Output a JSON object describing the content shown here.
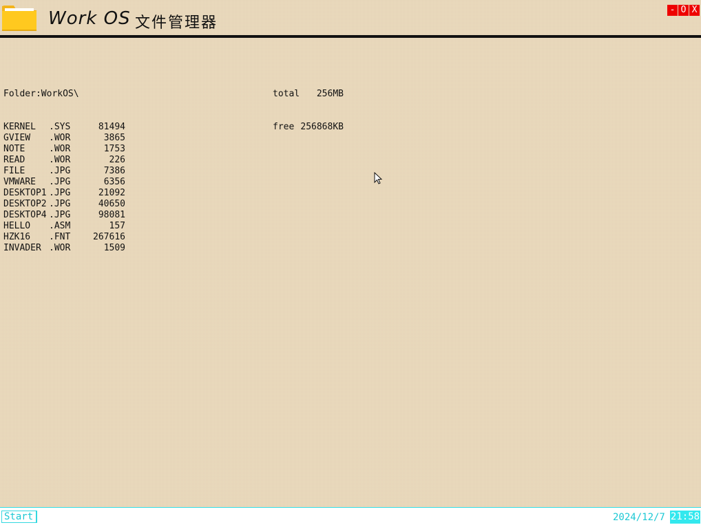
{
  "window": {
    "title": "Work OS",
    "title_cn": "文件管理器",
    "controls": {
      "minimize": "-",
      "maximize": "O",
      "close": "X"
    }
  },
  "folder": {
    "label": "Folder:WorkOS\\",
    "files": [
      {
        "name": "KERNEL",
        "ext": ".SYS",
        "size": "81494"
      },
      {
        "name": "GVIEW",
        "ext": ".WOR",
        "size": "3865"
      },
      {
        "name": "NOTE",
        "ext": ".WOR",
        "size": "1753"
      },
      {
        "name": "READ",
        "ext": ".WOR",
        "size": "226"
      },
      {
        "name": "FILE",
        "ext": ".JPG",
        "size": "7386"
      },
      {
        "name": "VMWARE",
        "ext": ".JPG",
        "size": "6356"
      },
      {
        "name": "DESKTOP1",
        "ext": ".JPG",
        "size": "21092"
      },
      {
        "name": "DESKTOP2",
        "ext": ".JPG",
        "size": "40650"
      },
      {
        "name": "DESKTOP4",
        "ext": ".JPG",
        "size": "98081"
      },
      {
        "name": "HELLO",
        "ext": ".ASM",
        "size": "157"
      },
      {
        "name": "HZK16",
        "ext": ".FNT",
        "size": "267616"
      },
      {
        "name": "INVADER",
        "ext": ".WOR",
        "size": "1509"
      }
    ]
  },
  "disk": {
    "total_label": "total",
    "total_value": "256MB",
    "free_label": "free",
    "free_value": "256868KB"
  },
  "taskbar": {
    "start_label": "Start",
    "date": "2024/12/7",
    "time": "21:58"
  },
  "colors": {
    "background": "#ead9bb",
    "accent": "#33e8ee",
    "close_red": "#ee0000",
    "folder_yellow": "#f5c518"
  }
}
